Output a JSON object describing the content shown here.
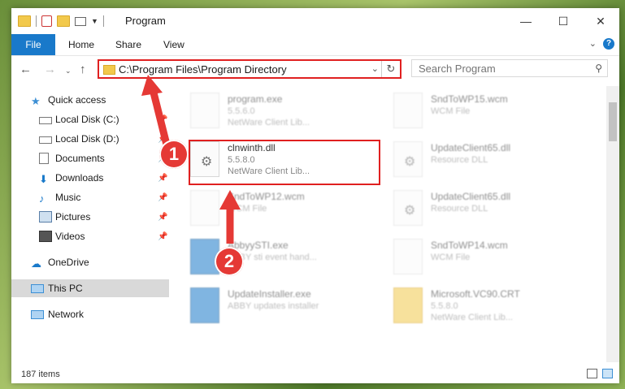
{
  "window": {
    "title": "Program"
  },
  "ribbon": {
    "file": "File",
    "tabs": [
      "Home",
      "Share",
      "View"
    ],
    "help": "?"
  },
  "nav": {
    "address": "C:\\Program Files\\Program Directory",
    "search_placeholder": "Search Program"
  },
  "sidebar": {
    "items": [
      {
        "label": "Quick access",
        "icon": "star-icon",
        "pinned": false
      },
      {
        "label": "Local Disk (C:)",
        "icon": "drive-icon",
        "pinned": true
      },
      {
        "label": "Local Disk (D:)",
        "icon": "drive-icon",
        "pinned": true
      },
      {
        "label": "Documents",
        "icon": "documents-icon",
        "pinned": true
      },
      {
        "label": "Downloads",
        "icon": "download-icon",
        "pinned": true
      },
      {
        "label": "Music",
        "icon": "music-icon",
        "pinned": true
      },
      {
        "label": "Pictures",
        "icon": "pictures-icon",
        "pinned": true
      },
      {
        "label": "Videos",
        "icon": "videos-icon",
        "pinned": true
      },
      {
        "label": "OneDrive",
        "icon": "cloud-icon",
        "pinned": false
      },
      {
        "label": "This PC",
        "icon": "pc-icon",
        "pinned": false
      },
      {
        "label": "Network",
        "icon": "network-icon",
        "pinned": false
      }
    ]
  },
  "files": [
    {
      "name": "program.exe",
      "version": "5.5.6.0",
      "desc": "NetWare Client Lib..."
    },
    {
      "name": "SndToWP15.wcm",
      "version": "WCM File",
      "desc": ""
    },
    {
      "name": "clnwinth.dll",
      "version": "5.5.8.0",
      "desc": "NetWare Client Lib..."
    },
    {
      "name": "UpdateClient65.dll",
      "version": "Resource DLL",
      "desc": ""
    },
    {
      "name": "SndToWP12.wcm",
      "version": "WCM File",
      "desc": ""
    },
    {
      "name": "UpdateClient65.dll",
      "version": "Resource DLL",
      "desc": ""
    },
    {
      "name": "AbbyySTI.exe",
      "version": "ABBY sti event hand...",
      "desc": ""
    },
    {
      "name": "SndToWP14.wcm",
      "version": "WCM File",
      "desc": ""
    },
    {
      "name": "UpdateInstaller.exe",
      "version": "ABBY updates installer",
      "desc": ""
    },
    {
      "name": "Microsoft.VC90.CRT",
      "version": "5.5.8.0",
      "desc": "NetWare Client Lib..."
    }
  ],
  "status": {
    "items": "187 items"
  },
  "badges": [
    "1",
    "2"
  ],
  "colors": {
    "accent": "#1979ca",
    "highlight": "#e02020",
    "badge": "#e53935"
  }
}
